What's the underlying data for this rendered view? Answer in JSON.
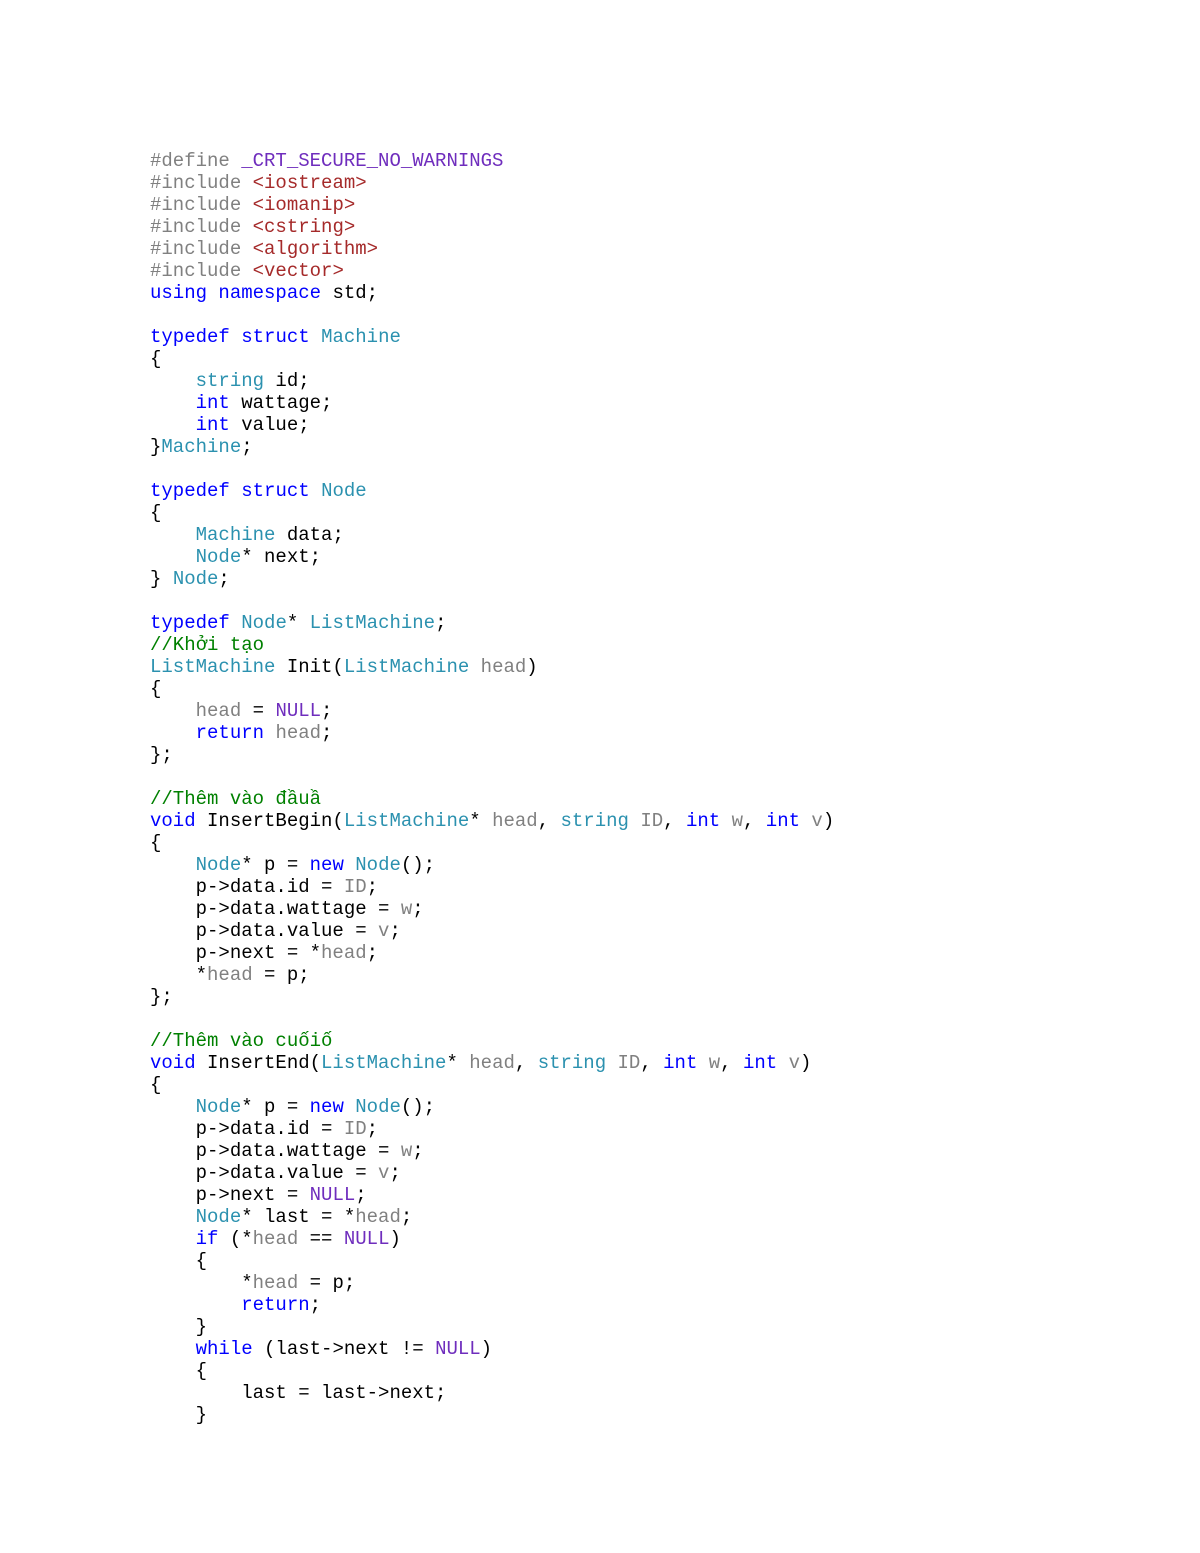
{
  "code": {
    "lines": [
      [
        {
          "cls": "preproc",
          "t": "#define "
        },
        {
          "cls": "macro",
          "t": "_CRT_SECURE_NO_WARNINGS"
        }
      ],
      [
        {
          "cls": "preproc",
          "t": "#include "
        },
        {
          "cls": "include",
          "t": "<iostream>"
        }
      ],
      [
        {
          "cls": "preproc",
          "t": "#include "
        },
        {
          "cls": "include",
          "t": "<iomanip>"
        }
      ],
      [
        {
          "cls": "preproc",
          "t": "#include "
        },
        {
          "cls": "include",
          "t": "<cstring>"
        }
      ],
      [
        {
          "cls": "preproc",
          "t": "#include "
        },
        {
          "cls": "include",
          "t": "<algorithm>"
        }
      ],
      [
        {
          "cls": "preproc",
          "t": "#include "
        },
        {
          "cls": "include",
          "t": "<vector>"
        }
      ],
      [
        {
          "cls": "keyword",
          "t": "using"
        },
        {
          "cls": "def",
          "t": " "
        },
        {
          "cls": "keyword",
          "t": "namespace"
        },
        {
          "cls": "def",
          "t": " std;"
        }
      ],
      [],
      [
        {
          "cls": "keyword",
          "t": "typedef"
        },
        {
          "cls": "def",
          "t": " "
        },
        {
          "cls": "keyword",
          "t": "struct"
        },
        {
          "cls": "def",
          "t": " "
        },
        {
          "cls": "type",
          "t": "Machine"
        }
      ],
      [
        {
          "cls": "def",
          "t": "{"
        }
      ],
      [
        {
          "cls": "def",
          "t": "    "
        },
        {
          "cls": "type",
          "t": "string"
        },
        {
          "cls": "def",
          "t": " id;"
        }
      ],
      [
        {
          "cls": "def",
          "t": "    "
        },
        {
          "cls": "keyword",
          "t": "int"
        },
        {
          "cls": "def",
          "t": " wattage;"
        }
      ],
      [
        {
          "cls": "def",
          "t": "    "
        },
        {
          "cls": "keyword",
          "t": "int"
        },
        {
          "cls": "def",
          "t": " value;"
        }
      ],
      [
        {
          "cls": "def",
          "t": "}"
        },
        {
          "cls": "type",
          "t": "Machine"
        },
        {
          "cls": "def",
          "t": ";"
        }
      ],
      [],
      [
        {
          "cls": "keyword",
          "t": "typedef"
        },
        {
          "cls": "def",
          "t": " "
        },
        {
          "cls": "keyword",
          "t": "struct"
        },
        {
          "cls": "def",
          "t": " "
        },
        {
          "cls": "type",
          "t": "Node"
        }
      ],
      [
        {
          "cls": "def",
          "t": "{"
        }
      ],
      [
        {
          "cls": "def",
          "t": "    "
        },
        {
          "cls": "type",
          "t": "Machine"
        },
        {
          "cls": "def",
          "t": " data;"
        }
      ],
      [
        {
          "cls": "def",
          "t": "    "
        },
        {
          "cls": "type",
          "t": "Node"
        },
        {
          "cls": "def",
          "t": "* next;"
        }
      ],
      [
        {
          "cls": "def",
          "t": "} "
        },
        {
          "cls": "type",
          "t": "Node"
        },
        {
          "cls": "def",
          "t": ";"
        }
      ],
      [],
      [
        {
          "cls": "keyword",
          "t": "typedef"
        },
        {
          "cls": "def",
          "t": " "
        },
        {
          "cls": "type",
          "t": "Node"
        },
        {
          "cls": "def",
          "t": "* "
        },
        {
          "cls": "type",
          "t": "ListMachine"
        },
        {
          "cls": "def",
          "t": ";"
        }
      ],
      [
        {
          "cls": "comment",
          "t": "//Khởi tạo"
        }
      ],
      [
        {
          "cls": "type",
          "t": "ListMachine"
        },
        {
          "cls": "def",
          "t": " Init("
        },
        {
          "cls": "type",
          "t": "ListMachine"
        },
        {
          "cls": "def",
          "t": " "
        },
        {
          "cls": "preproc",
          "t": "head"
        },
        {
          "cls": "def",
          "t": ")"
        }
      ],
      [
        {
          "cls": "def",
          "t": "{"
        }
      ],
      [
        {
          "cls": "def",
          "t": "    "
        },
        {
          "cls": "preproc",
          "t": "head"
        },
        {
          "cls": "def",
          "t": " = "
        },
        {
          "cls": "macro",
          "t": "NULL"
        },
        {
          "cls": "def",
          "t": ";"
        }
      ],
      [
        {
          "cls": "def",
          "t": "    "
        },
        {
          "cls": "keyword",
          "t": "return"
        },
        {
          "cls": "def",
          "t": " "
        },
        {
          "cls": "preproc",
          "t": "head"
        },
        {
          "cls": "def",
          "t": ";"
        }
      ],
      [
        {
          "cls": "def",
          "t": "};"
        }
      ],
      [],
      [
        {
          "cls": "comment",
          "t": "//Thêm vào đầuầ"
        }
      ],
      [
        {
          "cls": "keyword",
          "t": "void"
        },
        {
          "cls": "def",
          "t": " InsertBegin("
        },
        {
          "cls": "type",
          "t": "ListMachine"
        },
        {
          "cls": "def",
          "t": "* "
        },
        {
          "cls": "preproc",
          "t": "head"
        },
        {
          "cls": "def",
          "t": ", "
        },
        {
          "cls": "type",
          "t": "string"
        },
        {
          "cls": "def",
          "t": " "
        },
        {
          "cls": "preproc",
          "t": "ID"
        },
        {
          "cls": "def",
          "t": ", "
        },
        {
          "cls": "keyword",
          "t": "int"
        },
        {
          "cls": "def",
          "t": " "
        },
        {
          "cls": "preproc",
          "t": "w"
        },
        {
          "cls": "def",
          "t": ", "
        },
        {
          "cls": "keyword",
          "t": "int"
        },
        {
          "cls": "def",
          "t": " "
        },
        {
          "cls": "preproc",
          "t": "v"
        },
        {
          "cls": "def",
          "t": ")"
        }
      ],
      [
        {
          "cls": "def",
          "t": "{"
        }
      ],
      [
        {
          "cls": "def",
          "t": "    "
        },
        {
          "cls": "type",
          "t": "Node"
        },
        {
          "cls": "def",
          "t": "* p = "
        },
        {
          "cls": "keyword",
          "t": "new"
        },
        {
          "cls": "def",
          "t": " "
        },
        {
          "cls": "type",
          "t": "Node"
        },
        {
          "cls": "def",
          "t": "();"
        }
      ],
      [
        {
          "cls": "def",
          "t": "    p->data.id = "
        },
        {
          "cls": "preproc",
          "t": "ID"
        },
        {
          "cls": "def",
          "t": ";"
        }
      ],
      [
        {
          "cls": "def",
          "t": "    p->data.wattage = "
        },
        {
          "cls": "preproc",
          "t": "w"
        },
        {
          "cls": "def",
          "t": ";"
        }
      ],
      [
        {
          "cls": "def",
          "t": "    p->data.value = "
        },
        {
          "cls": "preproc",
          "t": "v"
        },
        {
          "cls": "def",
          "t": ";"
        }
      ],
      [
        {
          "cls": "def",
          "t": "    p->next = *"
        },
        {
          "cls": "preproc",
          "t": "head"
        },
        {
          "cls": "def",
          "t": ";"
        }
      ],
      [
        {
          "cls": "def",
          "t": "    *"
        },
        {
          "cls": "preproc",
          "t": "head"
        },
        {
          "cls": "def",
          "t": " = p;"
        }
      ],
      [
        {
          "cls": "def",
          "t": "};"
        }
      ],
      [],
      [
        {
          "cls": "comment",
          "t": "//Thêm vào cuốiố"
        }
      ],
      [
        {
          "cls": "keyword",
          "t": "void"
        },
        {
          "cls": "def",
          "t": " InsertEnd("
        },
        {
          "cls": "type",
          "t": "ListMachine"
        },
        {
          "cls": "def",
          "t": "* "
        },
        {
          "cls": "preproc",
          "t": "head"
        },
        {
          "cls": "def",
          "t": ", "
        },
        {
          "cls": "type",
          "t": "string"
        },
        {
          "cls": "def",
          "t": " "
        },
        {
          "cls": "preproc",
          "t": "ID"
        },
        {
          "cls": "def",
          "t": ", "
        },
        {
          "cls": "keyword",
          "t": "int"
        },
        {
          "cls": "def",
          "t": " "
        },
        {
          "cls": "preproc",
          "t": "w"
        },
        {
          "cls": "def",
          "t": ", "
        },
        {
          "cls": "keyword",
          "t": "int"
        },
        {
          "cls": "def",
          "t": " "
        },
        {
          "cls": "preproc",
          "t": "v"
        },
        {
          "cls": "def",
          "t": ")"
        }
      ],
      [
        {
          "cls": "def",
          "t": "{"
        }
      ],
      [
        {
          "cls": "def",
          "t": "    "
        },
        {
          "cls": "type",
          "t": "Node"
        },
        {
          "cls": "def",
          "t": "* p = "
        },
        {
          "cls": "keyword",
          "t": "new"
        },
        {
          "cls": "def",
          "t": " "
        },
        {
          "cls": "type",
          "t": "Node"
        },
        {
          "cls": "def",
          "t": "();"
        }
      ],
      [
        {
          "cls": "def",
          "t": "    p->data.id = "
        },
        {
          "cls": "preproc",
          "t": "ID"
        },
        {
          "cls": "def",
          "t": ";"
        }
      ],
      [
        {
          "cls": "def",
          "t": "    p->data.wattage = "
        },
        {
          "cls": "preproc",
          "t": "w"
        },
        {
          "cls": "def",
          "t": ";"
        }
      ],
      [
        {
          "cls": "def",
          "t": "    p->data.value = "
        },
        {
          "cls": "preproc",
          "t": "v"
        },
        {
          "cls": "def",
          "t": ";"
        }
      ],
      [
        {
          "cls": "def",
          "t": "    p->next = "
        },
        {
          "cls": "macro",
          "t": "NULL"
        },
        {
          "cls": "def",
          "t": ";"
        }
      ],
      [
        {
          "cls": "def",
          "t": "    "
        },
        {
          "cls": "type",
          "t": "Node"
        },
        {
          "cls": "def",
          "t": "* last = *"
        },
        {
          "cls": "preproc",
          "t": "head"
        },
        {
          "cls": "def",
          "t": ";"
        }
      ],
      [
        {
          "cls": "def",
          "t": "    "
        },
        {
          "cls": "keyword",
          "t": "if"
        },
        {
          "cls": "def",
          "t": " (*"
        },
        {
          "cls": "preproc",
          "t": "head"
        },
        {
          "cls": "def",
          "t": " == "
        },
        {
          "cls": "macro",
          "t": "NULL"
        },
        {
          "cls": "def",
          "t": ")"
        }
      ],
      [
        {
          "cls": "def",
          "t": "    {"
        }
      ],
      [
        {
          "cls": "def",
          "t": "        *"
        },
        {
          "cls": "preproc",
          "t": "head"
        },
        {
          "cls": "def",
          "t": " = p;"
        }
      ],
      [
        {
          "cls": "def",
          "t": "        "
        },
        {
          "cls": "keyword",
          "t": "return"
        },
        {
          "cls": "def",
          "t": ";"
        }
      ],
      [
        {
          "cls": "def",
          "t": "    }"
        }
      ],
      [
        {
          "cls": "def",
          "t": "    "
        },
        {
          "cls": "keyword",
          "t": "while"
        },
        {
          "cls": "def",
          "t": " (last->next != "
        },
        {
          "cls": "macro",
          "t": "NULL"
        },
        {
          "cls": "def",
          "t": ")"
        }
      ],
      [
        {
          "cls": "def",
          "t": "    {"
        }
      ],
      [
        {
          "cls": "def",
          "t": "        last = last->next;"
        }
      ],
      [
        {
          "cls": "def",
          "t": "    }"
        }
      ]
    ]
  }
}
